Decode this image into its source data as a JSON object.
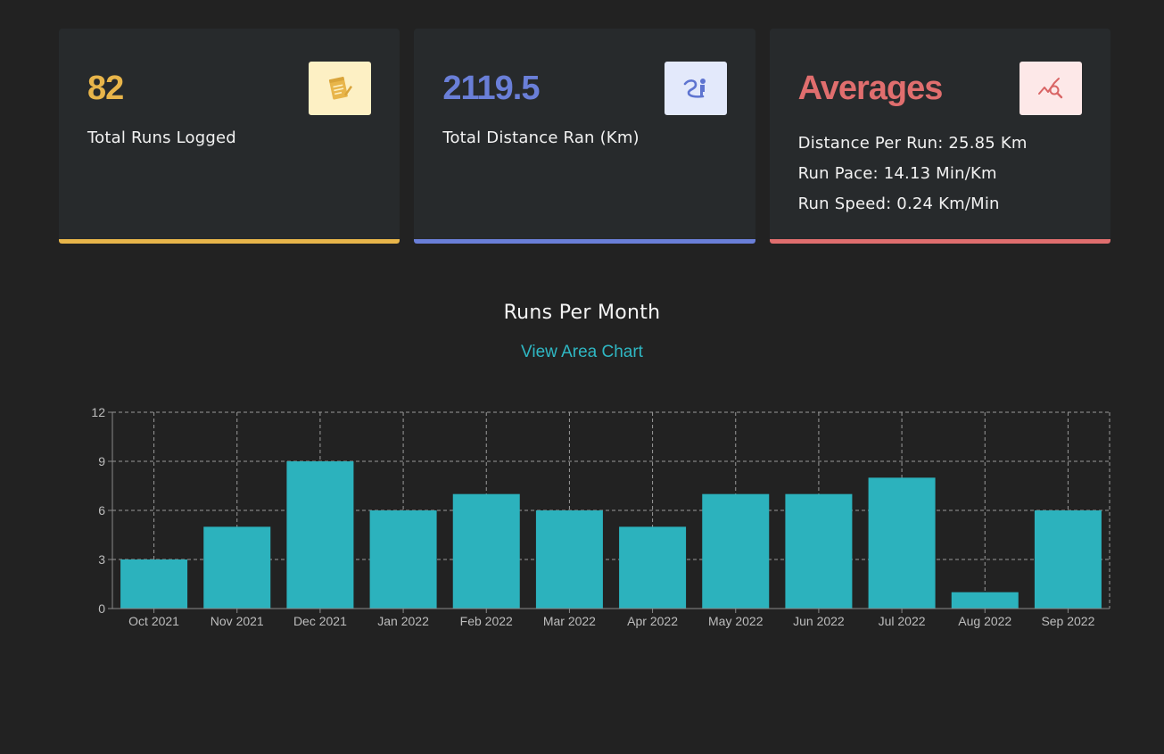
{
  "cards": {
    "runs": {
      "value": "82",
      "label": "Total Runs Logged",
      "color": "#e8b54a",
      "icon": "notepad-icon"
    },
    "distance": {
      "value": "2119.5",
      "label": "Total Distance Ran (Km)",
      "color": "#6a7fd8",
      "icon": "runner-icon"
    },
    "averages": {
      "value": "Averages",
      "color": "#e06e6e",
      "icon": "chart-search-icon",
      "lines": [
        "Distance Per Run: 25.85 Km",
        "Run Pace: 14.13 Min/Km",
        "Run Speed: 0.24 Km/Min"
      ]
    }
  },
  "chart": {
    "title": "Runs Per Month",
    "link": "View Area Chart"
  },
  "chart_data": {
    "type": "bar",
    "categories": [
      "Oct 2021",
      "Nov 2021",
      "Dec 2021",
      "Jan 2022",
      "Feb 2022",
      "Mar 2022",
      "Apr 2022",
      "May 2022",
      "Jun 2022",
      "Jul 2022",
      "Aug 2022",
      "Sep 2022"
    ],
    "values": [
      3,
      5,
      9,
      6,
      7,
      6,
      5,
      7,
      7,
      8,
      1,
      6
    ],
    "ylim": [
      0,
      12
    ],
    "yticks": [
      0,
      3,
      6,
      9,
      12
    ],
    "grid": true,
    "bar_color": "#2cb2bd"
  }
}
